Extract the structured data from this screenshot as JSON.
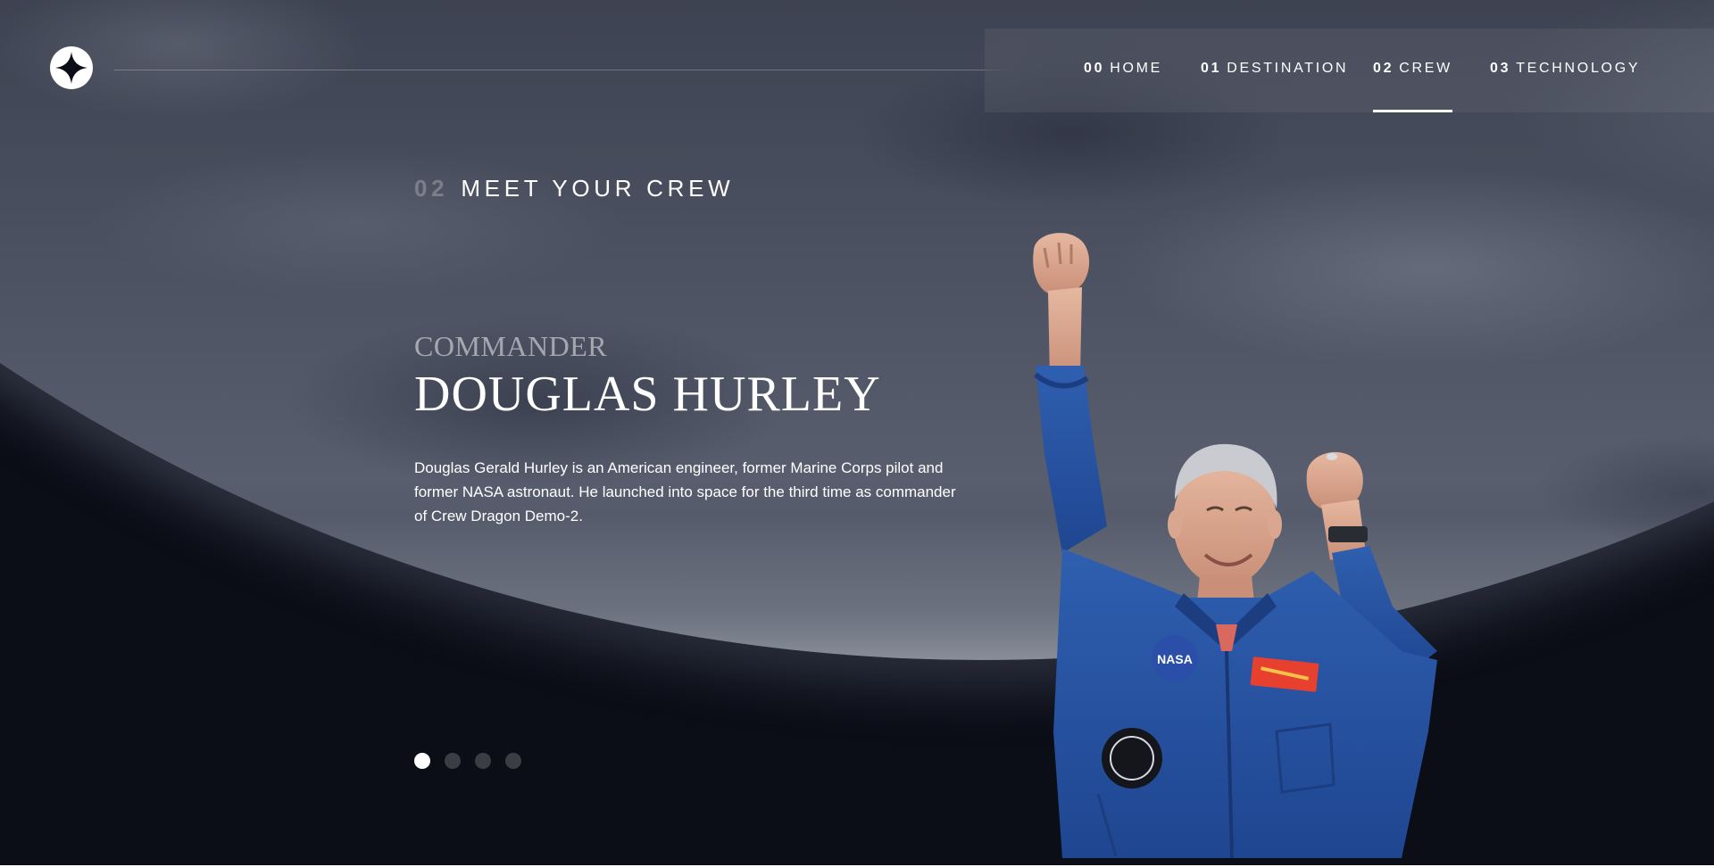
{
  "navigation": {
    "items": [
      {
        "number": "00",
        "label": "HOME",
        "active": false
      },
      {
        "number": "01",
        "label": "DESTINATION",
        "active": false
      },
      {
        "number": "02",
        "label": "CREW",
        "active": true
      },
      {
        "number": "03",
        "label": "TECHNOLOGY",
        "active": false
      }
    ]
  },
  "section": {
    "number": "02",
    "title": "MEET YOUR CREW"
  },
  "crew": {
    "role": "COMMANDER",
    "name": "DOUGLAS HURLEY",
    "bio": "Douglas Gerald Hurley is an American engineer, former Marine Corps pilot and former NASA astronaut. He launched into space for the third time as commander of Crew Dragon Demo-2."
  },
  "slider": {
    "total": 4,
    "active_index": 0
  },
  "icons": {
    "logo": "star-logo-icon"
  },
  "colors": {
    "background": "#0b0d17",
    "text": "#ffffff",
    "muted": "#a0a6b2",
    "suit_blue": "#2b59a8"
  }
}
